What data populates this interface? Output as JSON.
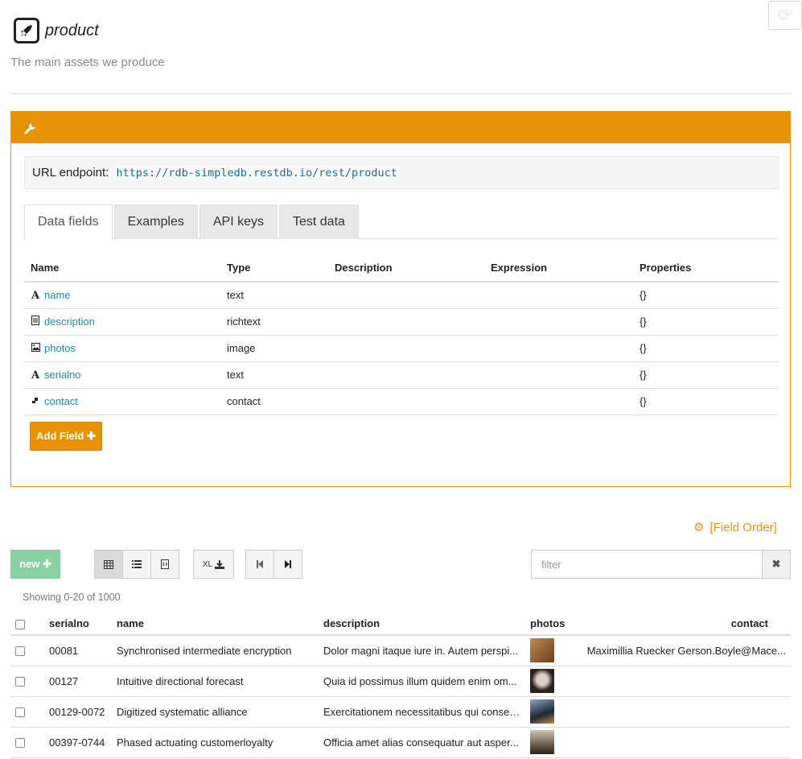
{
  "page": {
    "title": "product",
    "subtitle": "The main assets we produce"
  },
  "panel": {
    "endpoint_label": "URL endpoint:",
    "endpoint_url": "https://rdb-simpledb.restdb.io/rest/product",
    "tabs": [
      {
        "label": "Data fields",
        "active": true
      },
      {
        "label": "Examples",
        "active": false
      },
      {
        "label": "API keys",
        "active": false
      },
      {
        "label": "Test data",
        "active": false
      }
    ],
    "fields_columns": [
      "Name",
      "Type",
      "Description",
      "Expression",
      "Properties"
    ],
    "fields": [
      {
        "icon": "text-icon",
        "name": "name",
        "type": "text",
        "description": "",
        "expression": "",
        "properties": "{}"
      },
      {
        "icon": "document-icon",
        "name": "description",
        "type": "richtext",
        "description": "",
        "expression": "",
        "properties": "{}"
      },
      {
        "icon": "image-icon",
        "name": "photos",
        "type": "image",
        "description": "",
        "expression": "",
        "properties": "{}"
      },
      {
        "icon": "text-icon",
        "name": "serialno",
        "type": "text",
        "description": "",
        "expression": "",
        "properties": "{}"
      },
      {
        "icon": "contact-icon",
        "name": "contact",
        "type": "contact",
        "description": "",
        "expression": "",
        "properties": "{}"
      }
    ],
    "add_field_label": "Add Field ✚"
  },
  "records": {
    "field_order_label": "[Field Order]",
    "new_label": "new ✚",
    "export_label": "XL",
    "filter_placeholder": "filter",
    "clear_label": "✖",
    "showing": "Showing 0-20 of 1000",
    "columns": [
      "serialno",
      "name",
      "description",
      "photos",
      "contact"
    ],
    "rows": [
      {
        "serialno": "00081",
        "name": "Synchronised intermediate encryption",
        "description": "Dolor magni itaque iure in. Autem perspi...",
        "photo_color": "#a3673a",
        "contact": "Maximillia Ruecker Gerson.Boyle@Mace..."
      },
      {
        "serialno": "00127",
        "name": "Intuitive directional forecast",
        "description": "Quia id possimus illum quidem enim om...",
        "photo_color": "#4a3a30",
        "contact": ""
      },
      {
        "serialno": "00129-0072",
        "name": "Digitized systematic alliance",
        "description": "Exercitationem necessitatibus qui conseq...",
        "photo_color": "#3d4a5c",
        "contact": ""
      },
      {
        "serialno": "00397-0744",
        "name": "Phased actuating customerloyalty",
        "description": "Officia amet alias consequatur aut asper...",
        "photo_color": "#7a6a58",
        "contact": ""
      }
    ]
  },
  "colors": {
    "accent": "#ea9207",
    "link": "#1a8ab8",
    "new_button": "#8ad2a4"
  }
}
